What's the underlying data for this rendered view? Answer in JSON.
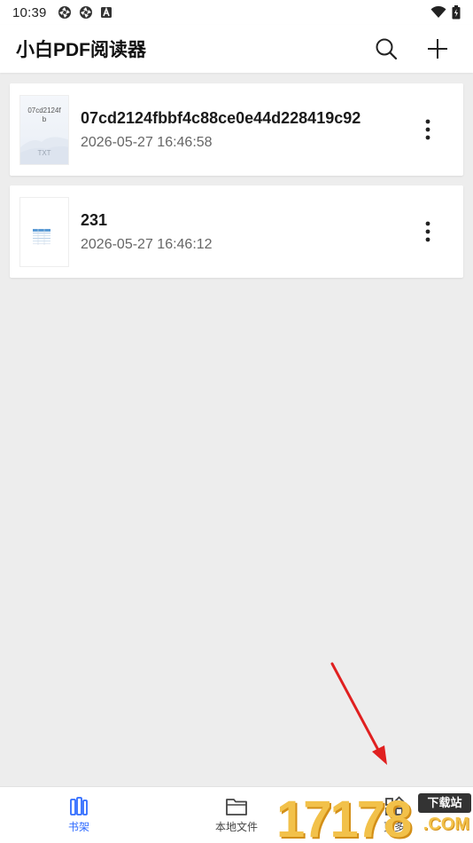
{
  "status_bar": {
    "time": "10:39",
    "icons": [
      "aperture-icon",
      "aperture-icon",
      "a-box-icon"
    ],
    "right_icons": [
      "wifi-icon",
      "battery-icon"
    ]
  },
  "app_bar": {
    "title": "小白PDF阅读器",
    "actions": [
      "search-icon",
      "plus-icon"
    ]
  },
  "files": [
    {
      "name": "07cd2124fbbf4c88ce0e44d228419c92",
      "date": "2026-05-27 16:46:58",
      "thumb_type": "txt",
      "thumb_text": "07cd2124f\nb",
      "thumb_label": "TXT"
    },
    {
      "name": "231",
      "date": "2026-05-27 16:46:12",
      "thumb_type": "sheet"
    }
  ],
  "bottom_nav": [
    {
      "label": "书架",
      "icon": "bookshelf-icon",
      "active": true
    },
    {
      "label": "本地文件",
      "icon": "folder-icon",
      "active": false
    },
    {
      "label": "更多",
      "icon": "grid-icon",
      "active": false
    }
  ],
  "watermark": {
    "digits": "17178",
    "badge": "下载站",
    "suffix": ".COM"
  },
  "colors": {
    "accent": "#2f6bff",
    "background": "#ededed",
    "arrow": "#e02020",
    "watermark_gold": "#f2c14a"
  }
}
